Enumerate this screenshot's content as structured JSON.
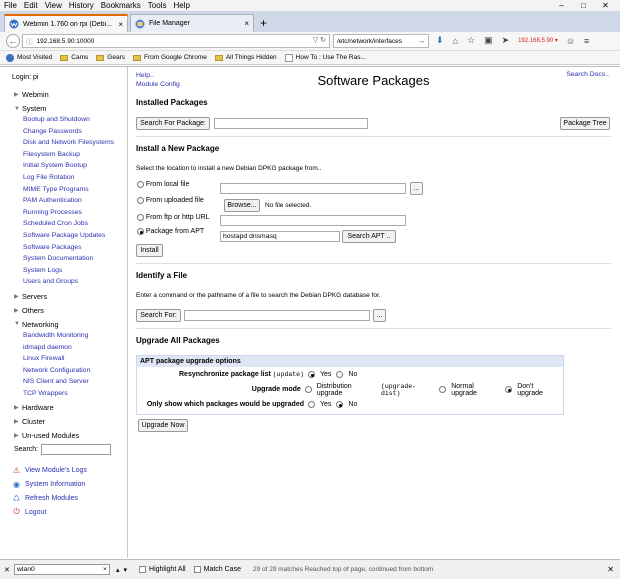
{
  "menubar": {
    "items": [
      "File",
      "Edit",
      "View",
      "History",
      "Bookmarks",
      "Tools",
      "Help"
    ],
    "controls": [
      "–",
      "□",
      "✕"
    ]
  },
  "tabs": [
    {
      "label": "Webmin 1.760 on rpi (Debi...",
      "icon": "webmin-icon",
      "close": "×"
    },
    {
      "label": "File Manager",
      "icon": "file-manager-icon",
      "close": "×"
    }
  ],
  "new_tab": "+",
  "nav": {
    "back": "←",
    "url_icon": "ⓘ",
    "url": "192.168.5.90:10000",
    "url_tail": "▽  ↻",
    "search_value": "/etc/network/interfaces",
    "search_go": "→",
    "icons": [
      "⬇",
      "⌂",
      "☆",
      "▣",
      "➤"
    ],
    "ip_badge": "192.168.5.90 ▾",
    "extra_icons": [
      "☺",
      "≡"
    ]
  },
  "bookmarks": [
    {
      "label": "Most Visited",
      "icon": "gear"
    },
    {
      "label": "Cams",
      "icon": "folder"
    },
    {
      "label": "Gears",
      "icon": "folder"
    },
    {
      "label": "From Google Chrome",
      "icon": "folder"
    },
    {
      "label": "All Things Hidden",
      "icon": "folder"
    },
    {
      "label": "How To : Use The Ras...",
      "icon": "page"
    }
  ],
  "sidebar": {
    "login": "Login: pi",
    "categories": {
      "webmin": "Webmin",
      "system": "System",
      "servers": "Servers",
      "others": "Others",
      "networking": "Networking",
      "hardware": "Hardware",
      "cluster": "Cluster",
      "unused": "Un-used Modules"
    },
    "system_modules": [
      "Bootup and Shutdown",
      "Change Passwords",
      "Disk and Network Filesystems",
      "Filesystem Backup",
      "Initial System Bootup",
      "Log File Rotation",
      "MIME Type Programs",
      "PAM Authentication",
      "Running Processes",
      "Scheduled Cron Jobs",
      "Software Package Updates",
      "Software Packages",
      "System Documentation",
      "System Logs",
      "Users and Groups"
    ],
    "networking_modules": [
      "Bandwidth Monitoring",
      "idmapd daemon",
      "Linux Firewall",
      "Network Configuration",
      "NIS Client and Server",
      "TCP Wrappers"
    ],
    "search_label": "Search:",
    "links": [
      {
        "label": "View Module's Logs",
        "icon": "⚠",
        "color": "#d04020"
      },
      {
        "label": "System Information",
        "icon": "◉",
        "color": "#2a70c8"
      },
      {
        "label": "Refresh Modules",
        "icon": "♺",
        "color": "#2a70c8"
      },
      {
        "label": "Logout",
        "icon": "⏻",
        "color": "#d02020"
      }
    ]
  },
  "main": {
    "help": "Help..",
    "module_config": "Module Config",
    "title": "Software Packages",
    "search_docs": "Search Docs..",
    "installed": {
      "heading": "Installed Packages",
      "search_button": "Search For Package:",
      "tree_button": "Package Tree"
    },
    "install": {
      "heading": "Install a New Package",
      "description": "Select the location to install a new Debian DPKG package from..",
      "local_file": "From local file",
      "browse_btn": "...",
      "uploaded": "From uploaded file",
      "browse": "Browse...",
      "no_file": "No file selected.",
      "ftp": "From ftp or http URL",
      "apt": "Package from APT",
      "apt_value": "hostapd dnsmasq",
      "search_apt": "Search APT ..",
      "install_btn": "Install"
    },
    "identify": {
      "heading": "Identify a File",
      "description": "Enter a command or the pathname of a file to search the Debian DPKG database for.",
      "search_for": "Search For:",
      "browse_btn": "..."
    },
    "upgrade": {
      "heading": "Upgrade All Packages",
      "options_title": "APT package upgrade options",
      "resync_label": "Resynchronize package list",
      "resync_code": "(update)",
      "resync_yes": "Yes",
      "resync_no": "No",
      "mode_label": "Upgrade mode",
      "mode_dist": "Distribution upgrade",
      "mode_dist_code": "(upgrade-dist)",
      "mode_normal": "Normal upgrade",
      "mode_none": "Don't upgrade",
      "show_label": "Only show which packages would be upgraded",
      "show_yes": "Yes",
      "show_no": "No",
      "upgrade_btn": "Upgrade Now"
    }
  },
  "findbar": {
    "close_x": "✕",
    "value": "wlan0",
    "value_clear": "×",
    "arrows": "▴▾",
    "highlight": "Highlight All",
    "match_case": "Match Case",
    "status": "29 of 29 matches    Reached top of page, continued from bottom",
    "close": "✕"
  }
}
